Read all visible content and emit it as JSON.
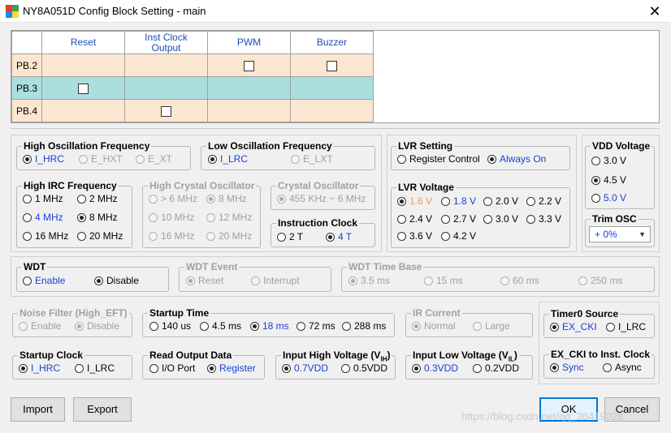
{
  "window": {
    "title": "NY8A051D Config Block Setting - main",
    "close_glyph": "✕"
  },
  "pin_table": {
    "columns": [
      "Reset",
      "Inst Clock\nOutput",
      "PWM",
      "Buzzer"
    ],
    "rows": [
      {
        "label": "PB.2",
        "checkboxes": [
          null,
          null,
          false,
          false
        ]
      },
      {
        "label": "PB.3",
        "checkboxes": [
          false,
          null,
          null,
          null
        ]
      },
      {
        "label": "PB.4",
        "checkboxes": [
          null,
          false,
          null,
          null
        ]
      }
    ],
    "colors": {
      "tan_row": "#fbe6cf",
      "teal_row": "#abdedf"
    }
  },
  "high_osc_freq": {
    "title": "High Oscillation Frequency",
    "options": [
      "I_HRC",
      "E_HXT",
      "E_XT"
    ],
    "selected": "I_HRC"
  },
  "low_osc_freq": {
    "title": "Low Oscillation Frequency",
    "options": [
      "I_LRC",
      "E_LXT"
    ],
    "selected": "I_LRC"
  },
  "lvr_setting": {
    "title": "LVR Setting",
    "options": [
      "Register Control",
      "Always On"
    ],
    "selected": "Always On"
  },
  "vdd_voltage": {
    "title": "VDD Voltage",
    "options": [
      "3.0 V",
      "4.5 V",
      "5.0 V"
    ],
    "selected": "4.5 V"
  },
  "high_irc_freq": {
    "title": "High IRC Frequency",
    "options": [
      "1 MHz",
      "2 MHz",
      "4 MHz",
      "8 MHz",
      "16 MHz",
      "20 MHz"
    ],
    "selected": "8 MHz"
  },
  "high_crystal_osc": {
    "title": "High Crystal Oscillator",
    "options": [
      "> 6 MHz",
      "8 MHz",
      "10 MHz",
      "12 MHz",
      "16 MHz",
      "20 MHz"
    ],
    "selected": "8 MHz"
  },
  "crystal_osc": {
    "title": "Crystal Oscillator",
    "options": [
      "455 KHz ~ 6 MHz"
    ],
    "selected": "455 KHz ~ 6 MHz"
  },
  "instruction_clock": {
    "title": "Instruction Clock",
    "options": [
      "2 T",
      "4 T"
    ],
    "selected": "4 T"
  },
  "lvr_voltage": {
    "title": "LVR Voltage",
    "options": [
      "1.6 V",
      "1.8 V",
      "2.0 V",
      "2.2 V",
      "2.4 V",
      "2.7 V",
      "3.0 V",
      "3.3 V",
      "3.6 V",
      "4.2 V"
    ],
    "selected": "1.6 V"
  },
  "trim_osc": {
    "title": "Trim OSC",
    "value": "+ 0%"
  },
  "wdt": {
    "title": "WDT",
    "options": [
      "Enable",
      "Disable"
    ],
    "selected": "Disable"
  },
  "wdt_event": {
    "title": "WDT Event",
    "options": [
      "Reset",
      "Interrupt"
    ],
    "selected": "Reset"
  },
  "wdt_time_base": {
    "title": "WDT Time Base",
    "options": [
      "3.5 ms",
      "15 ms",
      "60 ms",
      "250 ms"
    ],
    "selected": "3.5 ms"
  },
  "noise_filter": {
    "title": "Noise Filter (High_EFT)",
    "options": [
      "Enable",
      "Disable"
    ],
    "selected": "Disable"
  },
  "startup_time": {
    "title": "Startup Time",
    "options": [
      "140 us",
      "4.5 ms",
      "18 ms",
      "72 ms",
      "288 ms"
    ],
    "selected": "18 ms"
  },
  "ir_current": {
    "title": "IR Current",
    "options": [
      "Normal",
      "Large"
    ],
    "selected": "Normal"
  },
  "timer0_source": {
    "title": "Timer0 Source",
    "options": [
      "EX_CKI",
      "I_LRC"
    ],
    "selected": "EX_CKI"
  },
  "startup_clock": {
    "title": "Startup Clock",
    "options": [
      "I_HRC",
      "I_LRC"
    ],
    "selected": "I_HRC"
  },
  "read_output_data": {
    "title": "Read Output Data",
    "options": [
      "I/O Port",
      "Register"
    ],
    "selected": "Register"
  },
  "input_high_voltage": {
    "title": "Input High Voltage (V",
    "sub": "IH",
    "title_end": ")",
    "options": [
      "0.7VDD",
      "0.5VDD"
    ],
    "selected": "0.7VDD"
  },
  "input_low_voltage": {
    "title": "Input Low Voltage (V",
    "sub": "IL",
    "title_end": ")",
    "options": [
      "0.3VDD",
      "0.2VDD"
    ],
    "selected": "0.3VDD"
  },
  "ex_cki_to_inst_clock": {
    "title": "EX_CKI to Inst. Clock",
    "options": [
      "Sync",
      "Async"
    ],
    "selected": "Sync"
  },
  "buttons": {
    "import": "Import",
    "export": "Export",
    "ok": "OK",
    "cancel": "Cancel"
  },
  "watermark": "https://blog.csdn.net/qq_36419028"
}
